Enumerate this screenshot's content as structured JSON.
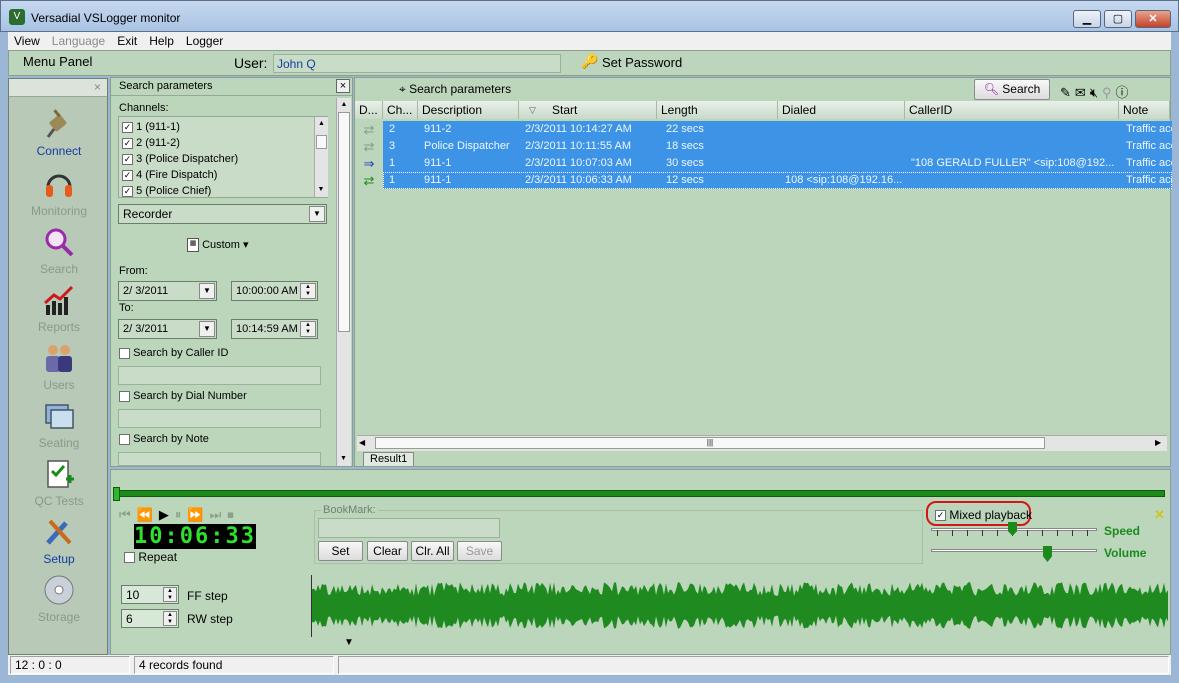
{
  "window": {
    "title": "Versadial VSLogger monitor"
  },
  "menu": {
    "items": [
      "View",
      "Language",
      "Exit",
      "Help",
      "Logger"
    ]
  },
  "userbar": {
    "menu_panel": "Menu Panel",
    "user_label": "User:",
    "user_value": "John Q",
    "set_password": "Set Password"
  },
  "leftpanel": {
    "items": [
      "Connect",
      "Monitoring",
      "Search",
      "Reports",
      "Users",
      "Seating",
      "QC Tests",
      "Setup",
      "Storage"
    ]
  },
  "search_panel": {
    "title": "Search parameters",
    "channels_label": "Channels:",
    "channels": [
      "1 (911-1)",
      "2 (911-2)",
      "3 (Police Dispatcher)",
      "4 (Fire Dispatch)",
      "5 (Police Chief)"
    ],
    "recorder": "Recorder",
    "custom": "Custom",
    "from_label": "From:",
    "from_date": "2/  3/2011",
    "from_time": "10:00:00 AM",
    "to_label": "To:",
    "to_date": "2/  3/2011",
    "to_time": "10:14:59 AM",
    "by_caller": "Search by Caller ID",
    "by_dial": "Search by Dial Number",
    "by_note": "Search by Note"
  },
  "results": {
    "header_title": "Search parameters",
    "search_button": "Search",
    "columns": [
      "D...",
      "Ch...",
      "Description",
      "Start",
      "Length",
      "Dialed",
      "CallerID",
      "Note"
    ],
    "rows": [
      {
        "ch": "2",
        "desc": "911-2",
        "start": "2/3/2011 10:14:27 AM",
        "length": "22 secs",
        "dialed": "",
        "caller": "",
        "note": "Traffic acc"
      },
      {
        "ch": "3",
        "desc": "Police Dispatcher",
        "start": "2/3/2011 10:11:55 AM",
        "length": "18 secs",
        "dialed": "",
        "caller": "",
        "note": "Traffic acc"
      },
      {
        "ch": "1",
        "desc": "911-1",
        "start": "2/3/2011 10:07:03 AM",
        "length": "30 secs",
        "dialed": "",
        "caller": "\"108 GERALD FULLER\" <sip:108@192...",
        "note": "Traffic acc"
      },
      {
        "ch": "1",
        "desc": "911-1",
        "start": "2/3/2011 10:06:33 AM",
        "length": "12 secs",
        "dialed": "108 <sip:108@192.16...",
        "caller": "",
        "note": "Traffic acc"
      }
    ],
    "tab": "Result1"
  },
  "playback": {
    "time": "10:06:33",
    "repeat": "Repeat",
    "bookmark_label": "BookMark:",
    "set": "Set",
    "clear": "Clear",
    "clr_all": "Clr. All",
    "save": "Save",
    "mixed": "Mixed playback",
    "speed": "Speed",
    "volume": "Volume",
    "ff_value": "10",
    "ff_label": "FF step",
    "rw_value": "6",
    "rw_label": "RW step"
  },
  "status": {
    "cell1": "12 : 0 : 0",
    "cell2": "4 records found"
  },
  "colors": {
    "selection": "#3d94e6",
    "panel": "#bcd6bc",
    "waveform": "#1f8a1f",
    "highlight": "#d01818"
  }
}
